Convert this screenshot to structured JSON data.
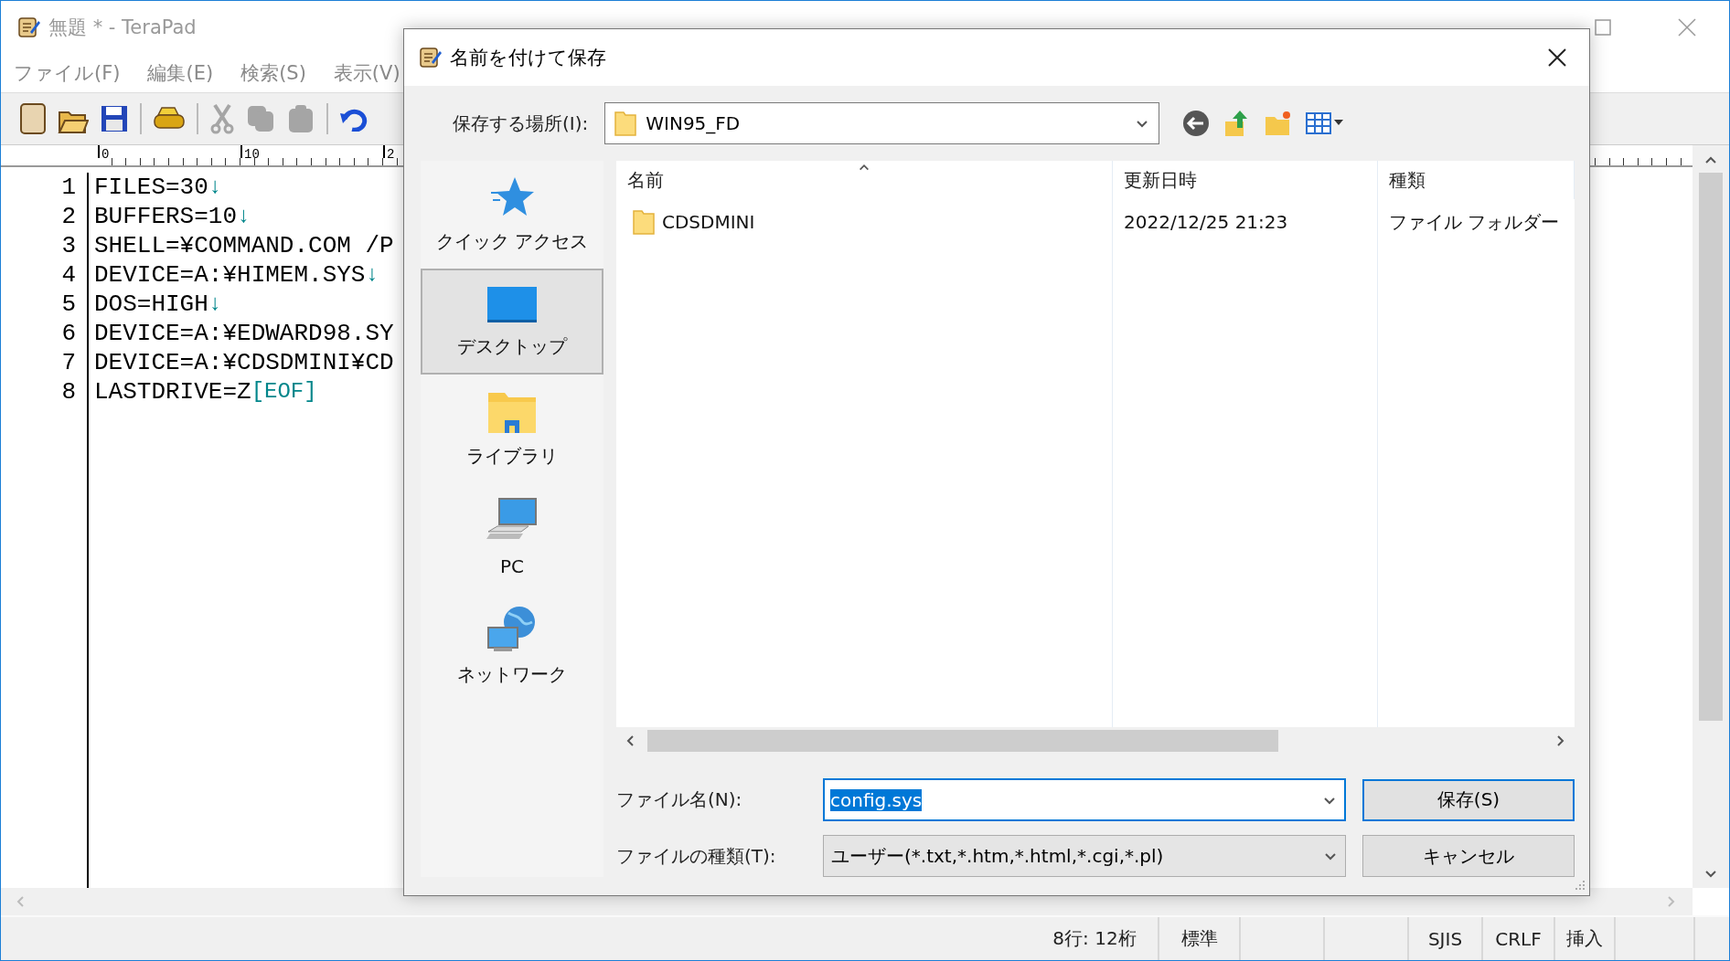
{
  "window": {
    "title": "無題 * - TeraPad"
  },
  "menu": [
    "ファイル(F)",
    "編集(E)",
    "検索(S)",
    "表示(V)"
  ],
  "toolbar": [
    {
      "kind": "button",
      "disabled": false
    },
    {
      "kind": "button",
      "disabled": false
    },
    {
      "kind": "button",
      "disabled": false
    },
    {
      "kind": "separator"
    },
    {
      "kind": "button",
      "disabled": false
    },
    {
      "kind": "separator"
    },
    {
      "kind": "button",
      "disabled": true
    },
    {
      "kind": "button",
      "disabled": true
    },
    {
      "kind": "button",
      "disabled": true
    },
    {
      "kind": "separator"
    },
    {
      "kind": "button",
      "disabled": false
    }
  ],
  "ruler": {
    "labels": [
      "0",
      "10",
      "2"
    ]
  },
  "editor": {
    "lines": [
      {
        "number": "1",
        "text": "FILES=30",
        "end": "↓"
      },
      {
        "number": "2",
        "text": "BUFFERS=10",
        "end": "↓"
      },
      {
        "number": "3",
        "text": "SHELL=¥COMMAND.COM /P"
      },
      {
        "number": "4",
        "text": "DEVICE=A:¥HIMEM.SYS",
        "end": "↓"
      },
      {
        "number": "5",
        "text": "DOS=HIGH",
        "end": "↓"
      },
      {
        "number": "6",
        "text": "DEVICE=A:¥EDWARD98.SY"
      },
      {
        "number": "7",
        "text": "DEVICE=A:¥CDSDMINI¥CD"
      },
      {
        "number": "8",
        "text": "LASTDRIVE=Z",
        "end": "[EOF]"
      }
    ]
  },
  "status_bar": [
    "8行: 12桁",
    "標準",
    "SJIS",
    "CRLF",
    "挿入"
  ],
  "dialog": {
    "title": "名前を付けて保存",
    "location": {
      "label": "保存する場所(I):",
      "value": "WIN95_FD"
    },
    "places": [
      {
        "label": "クイック アクセス",
        "selected": false
      },
      {
        "label": "デスクトップ",
        "selected": true
      },
      {
        "label": "ライブラリ",
        "selected": false
      },
      {
        "label": "PC",
        "selected": false
      },
      {
        "label": "ネットワーク",
        "selected": false
      }
    ],
    "columns": [
      "名前",
      "更新日時",
      "種類"
    ],
    "rows": [
      {
        "name": "CDSDMINI",
        "modified": "2022/12/25 21:23",
        "type": "ファイル フォルダー"
      }
    ],
    "file_name": {
      "label": "ファイル名(N):",
      "value": "config.sys",
      "selected": true
    },
    "file_type": {
      "label": "ファイルの種類(T):",
      "value": "ユーザー(*.txt,*.htm,*.html,*.cgi,*.pl)"
    },
    "buttons": [
      {
        "label": "保存(S)",
        "default": true
      },
      {
        "label": "キャンセル",
        "default": false
      }
    ]
  }
}
